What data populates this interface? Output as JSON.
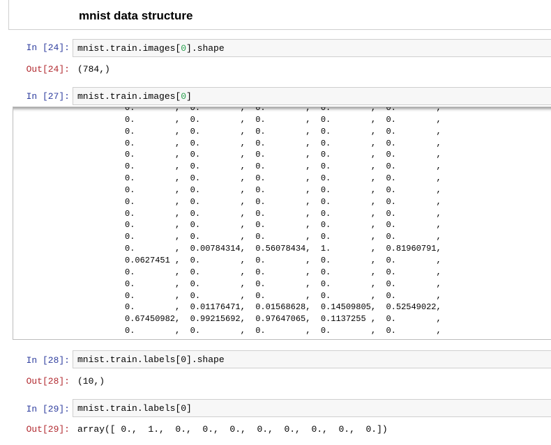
{
  "markdown": {
    "title": "mnist data structure"
  },
  "cells": {
    "c24": {
      "in_prompt": "In [24]:",
      "code_pre": "mnist.train.images[",
      "code_num": "0",
      "code_post": "].shape",
      "out_prompt": "Out[24]:",
      "output": "(784,)"
    },
    "c27": {
      "in_prompt": "In [27]:",
      "code_pre": "mnist.train.images[",
      "code_num": "0",
      "code_post": "]",
      "output_lines": [
        "0.        ,  0.        ,  0.        ,  0.        ,  0.        ,",
        "0.        ,  0.        ,  0.        ,  0.        ,  0.        ,",
        "0.        ,  0.        ,  0.        ,  0.        ,  0.        ,",
        "0.        ,  0.        ,  0.        ,  0.        ,  0.        ,",
        "0.        ,  0.        ,  0.        ,  0.        ,  0.        ,",
        "0.        ,  0.        ,  0.        ,  0.        ,  0.        ,",
        "0.        ,  0.        ,  0.        ,  0.        ,  0.        ,",
        "0.        ,  0.        ,  0.        ,  0.        ,  0.        ,",
        "0.        ,  0.        ,  0.        ,  0.        ,  0.        ,",
        "0.        ,  0.        ,  0.        ,  0.        ,  0.        ,",
        "0.        ,  0.        ,  0.        ,  0.        ,  0.        ,",
        "0.        ,  0.        ,  0.        ,  0.        ,  0.        ,",
        "0.        ,  0.00784314,  0.56078434,  1.        ,  0.81960791,",
        "0.0627451 ,  0.        ,  0.        ,  0.        ,  0.        ,",
        "0.        ,  0.        ,  0.        ,  0.        ,  0.        ,",
        "0.        ,  0.        ,  0.        ,  0.        ,  0.        ,",
        "0.        ,  0.        ,  0.        ,  0.        ,  0.        ,",
        "0.        ,  0.01176471,  0.01568628,  0.14509805,  0.52549022,",
        "0.67450982,  0.99215692,  0.97647065,  0.1137255 ,  0.        ,",
        "0.        ,  0.        ,  0.        ,  0.        ,  0.        ,"
      ]
    },
    "c28": {
      "in_prompt": "In [28]:",
      "code": "mnist.train.labels[0].shape",
      "out_prompt": "Out[28]:",
      "output": "(10,)"
    },
    "c29": {
      "in_prompt": "In [29]:",
      "code": "mnist.train.labels[0]",
      "out_prompt": "Out[29]:",
      "output": "array([ 0.,  1.,  0.,  0.,  0.,  0.,  0.,  0.,  0.,  0.])"
    }
  },
  "colors": {
    "in_prompt": "#303f9f",
    "out_prompt": "#b22b31",
    "number_literal": "#2aa14f",
    "input_bg": "#f7f7f7"
  }
}
